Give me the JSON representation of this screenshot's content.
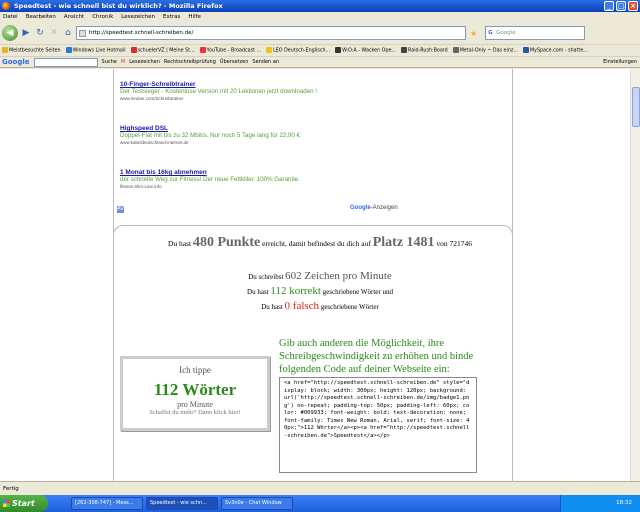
{
  "window": {
    "title": "Speedtest - wie schnell bist du wirklich? - Mozilla Firefox",
    "minimize": "_",
    "maximize": "□",
    "close": "×"
  },
  "menu": [
    "Datei",
    "Bearbeiten",
    "Ansicht",
    "Chronik",
    "Lesezeichen",
    "Extras",
    "Hilfe"
  ],
  "nav": {
    "back": "◀",
    "forward": "▶",
    "reload": "↻",
    "stop": "✕",
    "home": "⌂",
    "url": "http://speedtest.schnell-schreiben.de/",
    "search_placeholder": "Google"
  },
  "bookmarks": [
    "Meistbesuchte Seiten",
    "Windows Live Hotmail",
    "schuelerVZ | Meine St...",
    "YouTube - Broadcast ...",
    "LEO Deutsch-Englisch...",
    "W:O:A - Wacken Ope...",
    "Raid-Rush:Board",
    "Metal-Only ~ Das einz...",
    "MySpace.com - shatte..."
  ],
  "google_toolbar": {
    "logo": "Google",
    "search": "Suche",
    "lesezeichen": "Lesezeichen",
    "spell": "Rechtschreibprüfung",
    "translate": "Übersetzen",
    "send": "Senden an",
    "settings": "Einstellungen"
  },
  "ads": [
    {
      "title": "10-Finger-Schreibtrainer",
      "desc": "Der Testsieger - Kostenlose Version mit 20 Lektionen jetzt downloaden !",
      "url": "www.neuber.com/Schreibtrainer"
    },
    {
      "title": "Highspeed DSL",
      "desc": "Doppel-Flat mit bis zu 32 Mbit/s. Nur noch 5 Tage lang für 22,90 €",
      "url": "www.kabeldeutschland-internet.de"
    },
    {
      "title": "1 Monat bis 16kg abnehmen",
      "desc": "der schnelle Weg zur Fitness! Der neue Fettkiller. 100% Garantie.",
      "url": "fitness.Slim-Line.info"
    }
  ],
  "ads_footer": {
    "nav": "AV",
    "google": "Google",
    "label": "-Anzeigen"
  },
  "result": {
    "pre": "Du hast",
    "punkte": "480 Punkte",
    "mid": "erreicht, damit befindest du dich auf",
    "platz": "Platz 1481",
    "von": "von 721746",
    "line1_pre": "Du schreibst",
    "line1_val": "602 Zeichen pro Minute",
    "line2_pre": "Du hast",
    "line2_val": "112 korrekt",
    "line2_post": "geschriebene Wörter und",
    "line3_pre": "Du hast",
    "line3_val": "0 falsch",
    "line3_post": "geschriebene Wörter"
  },
  "badge": {
    "top": "Ich tippe",
    "value": "112 Wörter",
    "unit": "pro Minute",
    "sub": "Schaffst du mehr? Dann klick hier!"
  },
  "promo": "Gib auch anderen die Möglichkeit, ihre Schreibgeschwindigkeit zu erhöhen und binde folgenden Code auf deiner Webseite ein:",
  "code": "<a href=\"http://speedtest.schnell-schreiben.de\" style=\"display: block; width: 300px; height: 120px; background: url('http://speedtest.schnell-schreiben.de/img/badge1.png') no-repeat; padding-top: 50px; padding-left: 60px; color: #009933; font-weight: bold; text-decoration: none; font-family: Times New Roman, Arial, serif; font-size: 40px;\">112 Wörter</a><p><a href=\"http://speedtest.schnell-schreiben.de\">Speedtest</a></p>",
  "status": "Fertig",
  "taskbar": {
    "start": "Start",
    "tasks": [
      "[262-308-747] - Mess...",
      "Speedtest - wie schn...",
      "Sv3n0e - Chat Window"
    ],
    "time": "18:32"
  }
}
